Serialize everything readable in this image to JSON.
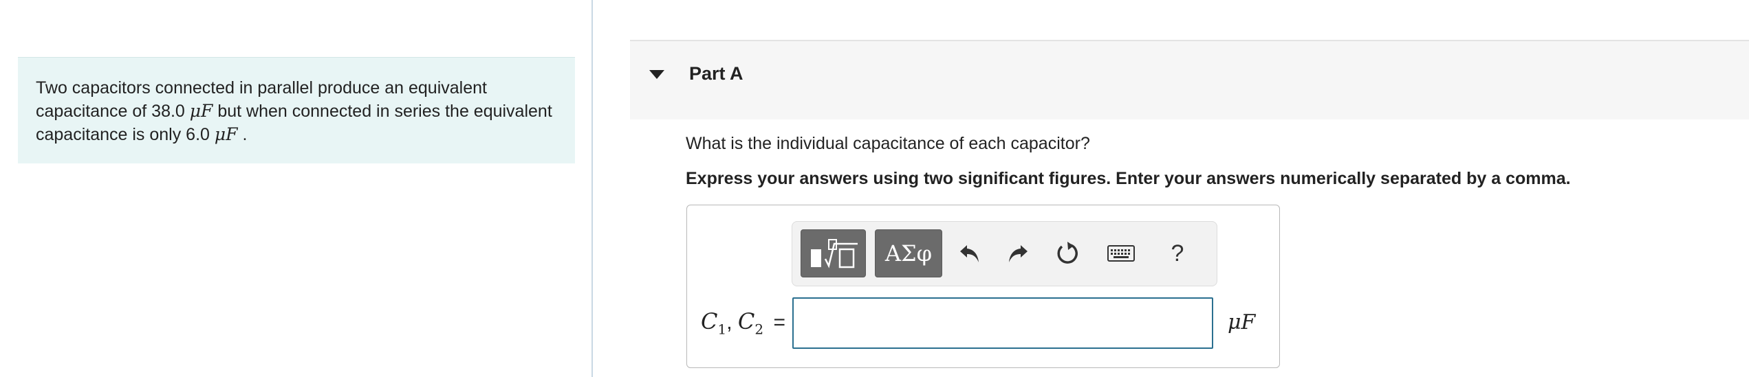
{
  "problem": {
    "text_1": "Two capacitors connected in parallel produce an equivalent capacitance of 38.0",
    "unit_1": "μF",
    "text_2": "but when connected in series the equivalent capacitance is only 6.0",
    "unit_2": "μF",
    "text_3": "."
  },
  "part": {
    "title": "Part A",
    "question": "What is the individual capacitance of each capacitor?",
    "instruction": "Express your answers using two significant figures. Enter your answers numerically separated by a comma."
  },
  "toolbar": {
    "symbols_label": "ΑΣφ",
    "help_label": "?",
    "icons": [
      "templates-icon",
      "symbols-icon",
      "undo-icon",
      "redo-icon",
      "reset-icon",
      "keyboard-icon",
      "help-icon"
    ]
  },
  "answer": {
    "var_1": "C",
    "sub_1": "1",
    "separator": ",",
    "var_2": "C",
    "sub_2": "2",
    "equals": "=",
    "value": "",
    "unit": "μF"
  },
  "colors": {
    "problem_bg": "#e8f5f5",
    "input_border": "#2a6f8f",
    "toolbar_button": "#6b6b6b"
  }
}
